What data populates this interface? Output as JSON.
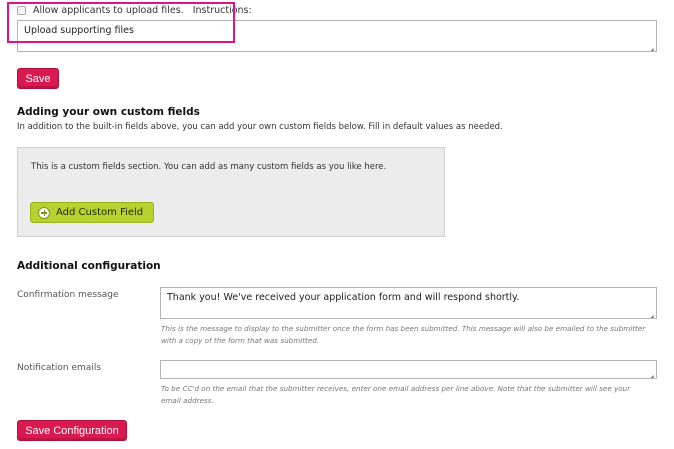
{
  "upload": {
    "checkbox_label": "Allow applicants to upload files.",
    "instructions_label": "Instructions:",
    "instructions_value": "Upload supporting files"
  },
  "save_label": "Save",
  "custom_fields": {
    "heading": "Adding your own custom fields",
    "description": "In addition to the built-in fields above, you can add your own custom fields below. Fill in default values as needed.",
    "box_text": "This is a custom fields section. You can add as many custom fields as you like here.",
    "add_button_label": "Add Custom Field"
  },
  "config": {
    "heading": "Additional configuration",
    "confirmation_label": "Confirmation message",
    "confirmation_value": "Thank you! We've received your application form and will respond shortly.",
    "confirmation_help": "This is the message to display to the submitter once the form has been submitted. This message will also be emailed to the submitter with a copy of the form that was submitted.",
    "notification_label": "Notification emails",
    "notification_value": "",
    "notification_help": "To be CC'd on the email that the submitter receives, enter one email address per line above. Note that the submitter will see your email address.",
    "save_config_label": "Save Configuration"
  },
  "colors": {
    "primary_button": "#d9194f",
    "add_button": "#b7d12e",
    "highlight": "#e0118a"
  }
}
